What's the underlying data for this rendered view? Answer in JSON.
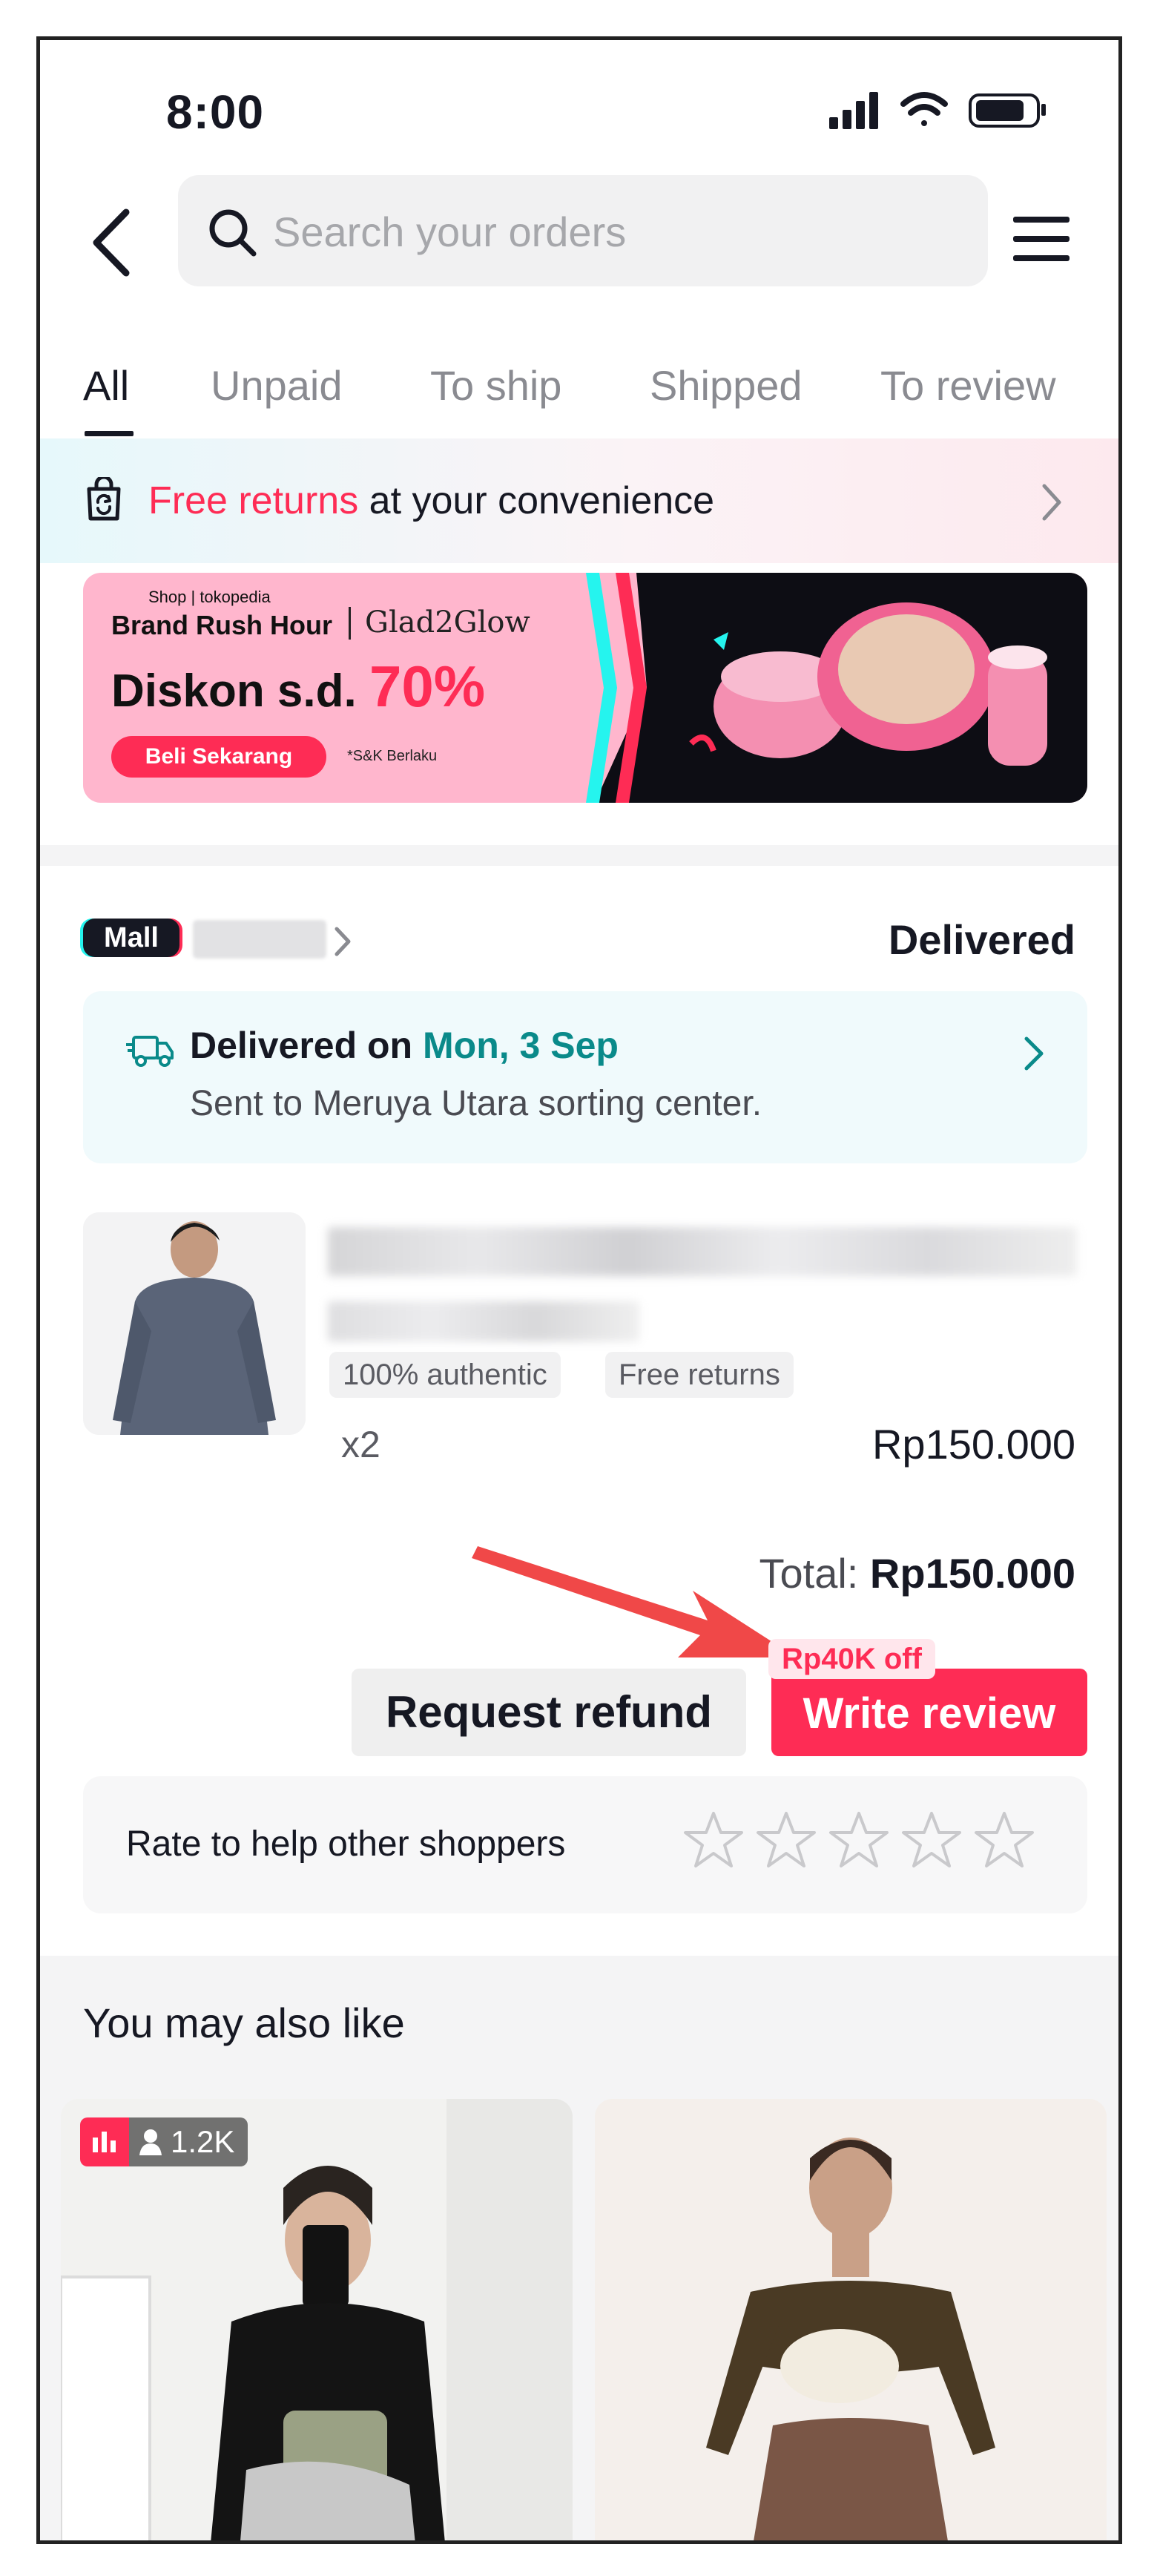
{
  "status_bar": {
    "time": "8:00"
  },
  "search": {
    "placeholder": "Search your orders"
  },
  "tabs": [
    {
      "label": "All",
      "active": true
    },
    {
      "label": "Unpaid",
      "active": false
    },
    {
      "label": "To ship",
      "active": false
    },
    {
      "label": "Shipped",
      "active": false
    },
    {
      "label": "To review",
      "active": false
    }
  ],
  "returns_banner": {
    "highlight": "Free returns",
    "text": " at your convenience"
  },
  "promo": {
    "small_label": "Shop | tokopedia",
    "title": "Brand Rush Hour",
    "brand": "Glad2Glow",
    "discount_prefix": "Diskon s.d.",
    "discount_value": "70%",
    "cta": "Beli Sekarang",
    "terms": "*S&K Berlaku"
  },
  "order": {
    "mall_badge": "Mall",
    "status": "Delivered",
    "delivery": {
      "prefix": "Delivered on ",
      "date": "Mon, 3 Sep",
      "detail": "Sent to Meruya Utara sorting center."
    },
    "product": {
      "tags": [
        "100% authentic",
        "Free returns"
      ],
      "quantity": "x2",
      "price": "Rp150.000"
    },
    "total_label": "Total: ",
    "total_value": "Rp150.000",
    "refund_button": "Request refund",
    "review_button": "Write review",
    "review_discount": "Rp40K off",
    "rate_prompt": "Rate to help other shoppers",
    "star_count": 5
  },
  "recommendations": {
    "title": "You may also like",
    "live_viewers": "1.2K"
  },
  "colors": {
    "accent": "#fe2c55",
    "teal": "#0a8a8a",
    "cyan": "#25f4ee"
  }
}
